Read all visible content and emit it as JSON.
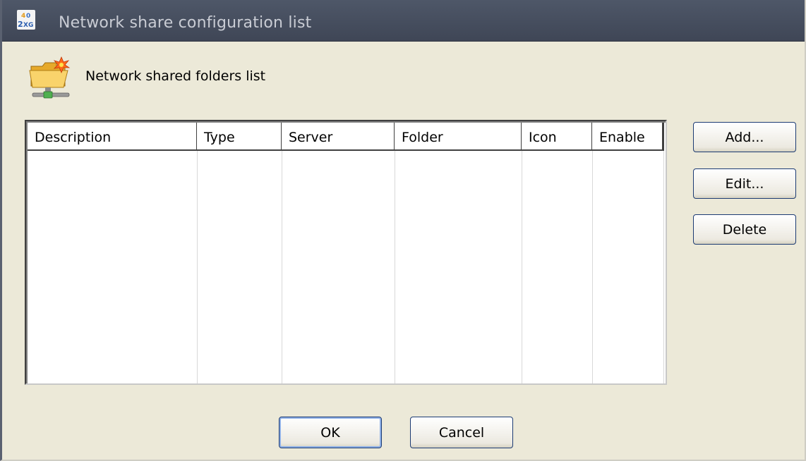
{
  "window": {
    "title": "Network share configuration list",
    "app_icon": "2xc-app-icon"
  },
  "header": {
    "icon": "network-folder-icon",
    "label": "Network shared folders list"
  },
  "table": {
    "columns": [
      "Description",
      "Type",
      "Server",
      "Folder",
      "Icon",
      "Enable"
    ],
    "rows": []
  },
  "side_buttons": {
    "add": "Add...",
    "edit": "Edit...",
    "delete": "Delete"
  },
  "bottom_buttons": {
    "ok": "OK",
    "cancel": "Cancel"
  }
}
